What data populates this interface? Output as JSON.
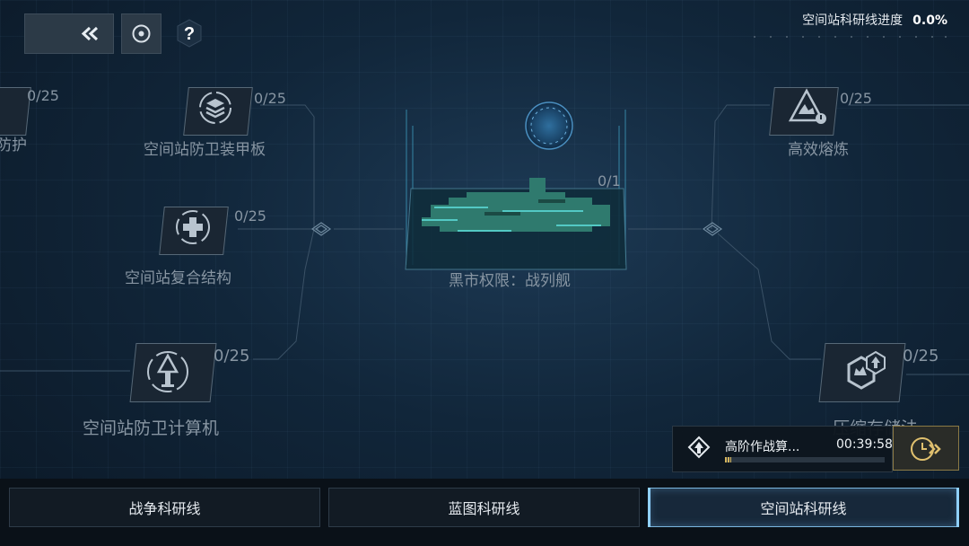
{
  "header": {
    "progress_label": "空间站科研线进度",
    "progress_value": "0.0%"
  },
  "nodes": [
    {
      "label": "防护",
      "count": "0/25"
    },
    {
      "label": "空间站防卫装甲板",
      "count": "0/25"
    },
    {
      "label": "空间站复合结构",
      "count": "0/25"
    },
    {
      "label": "空间站防卫计算机",
      "count": "0/25"
    },
    {
      "label": "黑市权限：战列舰",
      "count": "0/1"
    },
    {
      "label": "高效熔炼",
      "count": "0/25"
    },
    {
      "label": "压缩存储法",
      "count": "0/25"
    }
  ],
  "task": {
    "name": "高阶作战算...",
    "timer": "00:39:58",
    "progress": 0.04
  },
  "tabs": [
    {
      "label": "战争科研线",
      "active": false
    },
    {
      "label": "蓝图科研线",
      "active": false
    },
    {
      "label": "空间站科研线",
      "active": true
    }
  ],
  "colors": {
    "accent": "#8fd0ff",
    "gold": "#d4b45c",
    "label_dim": "#8795a2"
  }
}
